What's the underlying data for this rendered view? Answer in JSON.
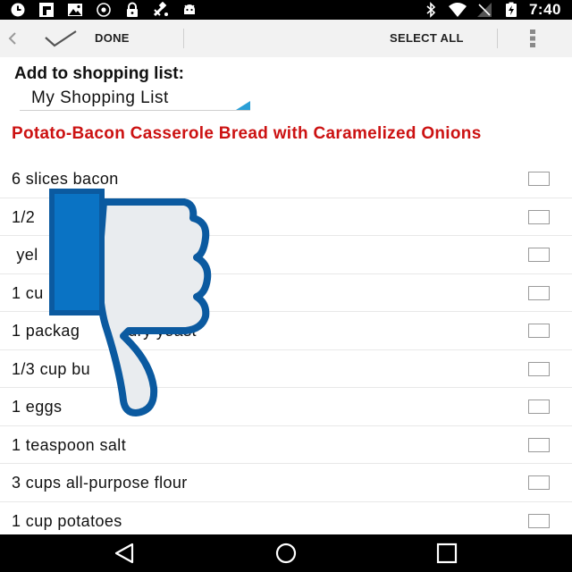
{
  "status_bar": {
    "time": "7:40",
    "left_icons": [
      "clock-icon",
      "flipboard-icon",
      "gallery-icon",
      "recycle-icon",
      "lock-icon",
      "satellite-icon",
      "android-icon"
    ],
    "right_icons": [
      "bluetooth-icon",
      "wifi-icon",
      "no-signal-icon",
      "battery-charging-icon"
    ]
  },
  "action_bar": {
    "done_label": "DONE",
    "select_all_label": "SELECT ALL"
  },
  "add_to_list": {
    "title": "Add to shopping list:",
    "selected_list": "My Shopping List"
  },
  "recipe": {
    "title": "Potato-Bacon Casserole Bread with Caramelized Onions"
  },
  "ingredients": [
    {
      "text": "6 slices bacon",
      "checked": false
    },
    {
      "text": "1/2",
      "checked": false
    },
    {
      "text": " yel",
      "checked": false
    },
    {
      "text": "1 cu",
      "checked": false
    },
    {
      "text": "1 packag          dry yeast",
      "checked": false
    },
    {
      "text": "1/3 cup bu      r",
      "checked": false
    },
    {
      "text": "1 eggs",
      "checked": false
    },
    {
      "text": "1 teaspoon salt",
      "checked": false
    },
    {
      "text": "3 cups all-purpose flour",
      "checked": false
    },
    {
      "text": "1 cup potatoes",
      "checked": false
    }
  ],
  "colors": {
    "recipe_title": "#cc1212",
    "thumb_blue": "#0a73c4",
    "thumb_outline": "#0b5aa0",
    "thumb_fill": "#e9ecef",
    "dropdown_accent": "#2a9fd6"
  },
  "nav_bar": {
    "buttons": [
      "back-icon",
      "home-icon",
      "recents-icon"
    ]
  }
}
